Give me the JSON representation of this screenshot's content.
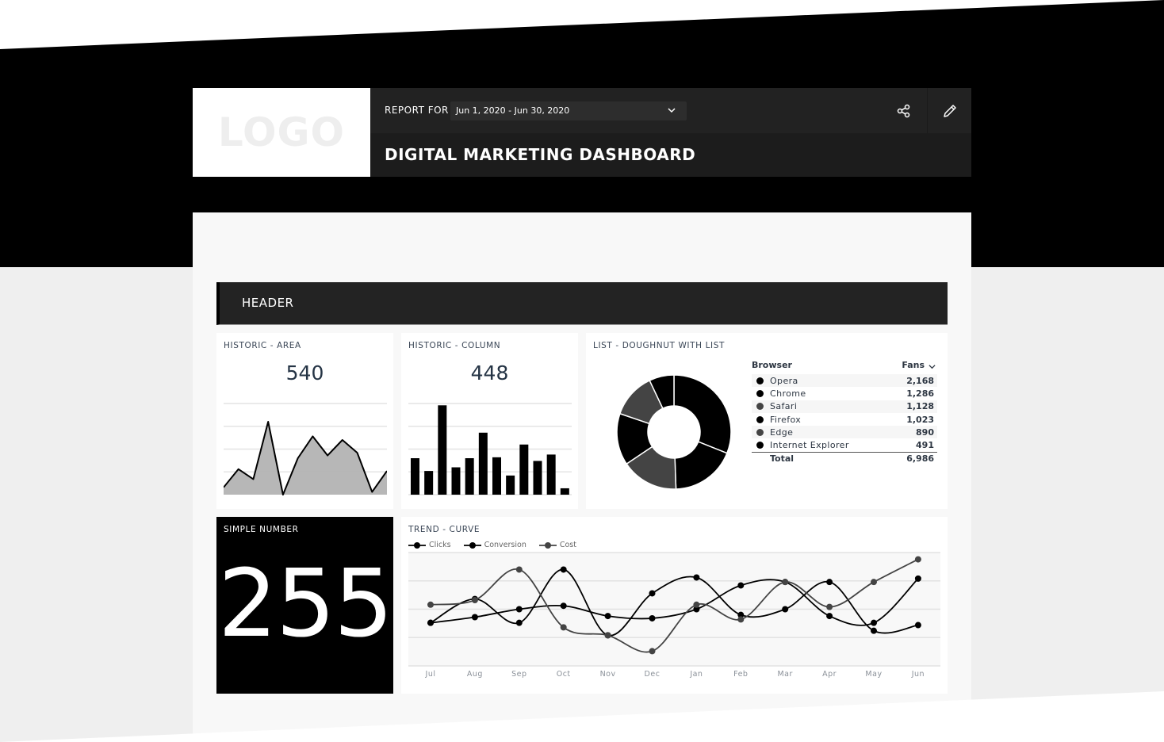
{
  "header": {
    "logo_text": "LOGO",
    "report_for_label": "REPORT FOR",
    "date_range": "Jun 1, 2020 - Jun 30, 2020",
    "title": "DIGITAL MARKETING DASHBOARD",
    "share_icon": "share-icon",
    "edit_icon": "pencil-icon"
  },
  "section": {
    "title": "HEADER"
  },
  "widgets": {
    "area": {
      "title": "HISTORIC - AREA",
      "value": "540"
    },
    "column": {
      "title": "HISTORIC - COLUMN",
      "value": "448"
    },
    "donut": {
      "title": "LIST - DOUGHNUT WITH LIST",
      "col_browser": "Browser",
      "col_fans": "Fans",
      "total_label": "Total",
      "total_value": "6,986"
    },
    "simple": {
      "title": "SIMPLE NUMBER",
      "value": "255"
    },
    "trend": {
      "title": "TREND - CURVE"
    }
  },
  "colors": {
    "black": "#000000",
    "dark_gray": "#444444",
    "area_fill": "#b3b3b3",
    "text_dark": "#253445"
  },
  "chart_data": [
    {
      "type": "area",
      "title": "HISTORIC - AREA",
      "values": [
        8,
        28,
        17,
        80,
        0,
        40,
        64,
        43,
        60,
        46,
        3,
        26
      ],
      "ylim": [
        0,
        100
      ],
      "grid": true
    },
    {
      "type": "bar",
      "title": "HISTORIC - COLUMN",
      "values": [
        40,
        26,
        98,
        30,
        40,
        68,
        41,
        21,
        55,
        37,
        44,
        7
      ],
      "ylim": [
        0,
        100
      ],
      "grid": true
    },
    {
      "type": "pie",
      "title": "LIST - DOUGHNUT WITH LIST",
      "doughnut": true,
      "slices": [
        {
          "label": "Opera",
          "value": 2168,
          "display": "2,168",
          "color": "#000000"
        },
        {
          "label": "Chrome",
          "value": 1286,
          "display": "1,286",
          "color": "#000000"
        },
        {
          "label": "Safari",
          "value": 1128,
          "display": "1,128",
          "color": "#444444"
        },
        {
          "label": "Firefox",
          "value": 1023,
          "display": "1,023",
          "color": "#000000"
        },
        {
          "label": "Edge",
          "value": 890,
          "display": "890",
          "color": "#444444"
        },
        {
          "label": "Internet Explorer",
          "value": 491,
          "display": "491",
          "color": "#000000"
        }
      ]
    },
    {
      "type": "line",
      "title": "TREND - CURVE",
      "x": [
        "Jul",
        "Aug",
        "Sep",
        "Oct",
        "Nov",
        "Dec",
        "Jan",
        "Feb",
        "Mar",
        "Apr",
        "May",
        "Jun"
      ],
      "ylim": [
        0,
        100
      ],
      "grid": true,
      "legend": "top-left",
      "series": [
        {
          "name": "Clicks",
          "color": "#000000",
          "values": [
            38,
            59,
            38,
            85,
            27,
            64,
            78,
            45,
            50,
            74,
            31,
            36
          ]
        },
        {
          "name": "Conversion",
          "color": "#000000",
          "values": [
            38,
            43,
            50,
            53,
            44,
            42,
            50,
            71,
            74,
            44,
            38,
            77
          ]
        },
        {
          "name": "Cost",
          "color": "#444444",
          "values": [
            54,
            58,
            85,
            34,
            27,
            13,
            54,
            41,
            74,
            52,
            74,
            94
          ]
        }
      ]
    }
  ]
}
